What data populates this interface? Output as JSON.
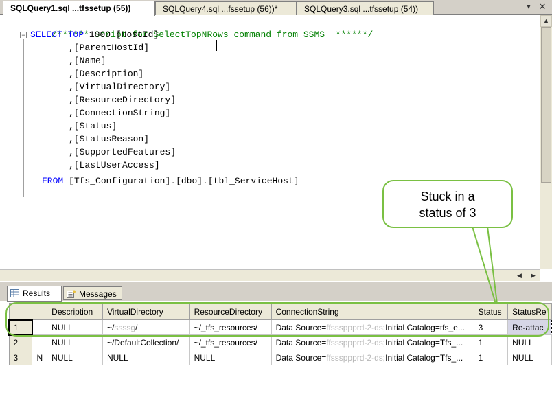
{
  "tabs": [
    {
      "label": "SQLQuery1.sql ...tfssetup (55))",
      "active": true
    },
    {
      "label": "SQLQuery4.sql ...fssetup (56))*",
      "active": false
    },
    {
      "label": "SQLQuery3.sql ...tfssetup (54))",
      "active": false
    }
  ],
  "tab_controls": {
    "dropdown": "▾",
    "close": "✕"
  },
  "editor": {
    "comment": "/****** Script for SelectTopNRows command from SSMS  ******/",
    "select_kw": "SELECT",
    "top_kw": "TOP",
    "top_n": "1000",
    "first_col": "[HostId]",
    "columns": [
      ",[ParentHostId]",
      ",[Name]",
      ",[Description]",
      ",[VirtualDirectory]",
      ",[ResourceDirectory]",
      ",[ConnectionString]",
      ",[Status]",
      ",[StatusReason]",
      ",[SupportedFeatures]",
      ",[LastUserAccess]"
    ],
    "from_kw": "FROM",
    "from_target_1": "[Tfs_Configuration]",
    "from_dot_1": ".",
    "from_target_2": "[dbo]",
    "from_dot_2": ".",
    "from_target_3": "[tbl_ServiceHost]",
    "collapse_glyph": "−"
  },
  "callout": {
    "line1": "Stuck in a",
    "line2": "status of 3"
  },
  "scroll": {
    "up": "▲",
    "left": "◀",
    "right": "▶"
  },
  "results_tabs": {
    "results": "Results",
    "messages": "Messages"
  },
  "grid": {
    "headers": [
      "",
      "Description",
      "VirtualDirectory",
      "ResourceDirectory",
      "ConnectionString",
      "Status",
      "StatusRe"
    ],
    "rows": [
      {
        "num": "1",
        "description": "NULL",
        "vdir_a": "~/",
        "vdir_blur": "ssssg",
        "vdir_b": "/",
        "rdir": "~/_tfs_resources/",
        "conn_a": "Data Source=",
        "conn_blur": "ffsssppprd-2-ds",
        "conn_b": ";Initial Catalog=tfs_e...",
        "status": "3",
        "reason": "Re-attac"
      },
      {
        "num": "2",
        "description": "NULL",
        "vdir": "~/DefaultCollection/",
        "rdir": "~/_tfs_resources/",
        "conn_a": "Data Source=",
        "conn_blur": "ffsssppprd-2-ds",
        "conn_b": ";Initial Catalog=Tfs_...",
        "status": "1",
        "reason": "NULL"
      },
      {
        "num": "3",
        "num_suffix": "N",
        "description": "NULL",
        "vdir": "NULL",
        "rdir": "NULL",
        "conn_a": "Data Source=",
        "conn_blur": "ffsssppprd-2-ds",
        "conn_b": ";Initial Catalog=Tfs_...",
        "status": "1",
        "reason": "NULL"
      }
    ]
  },
  "colors": {
    "keyword": "#0000ff",
    "comment": "#008000",
    "callout_border": "#7ac043"
  }
}
